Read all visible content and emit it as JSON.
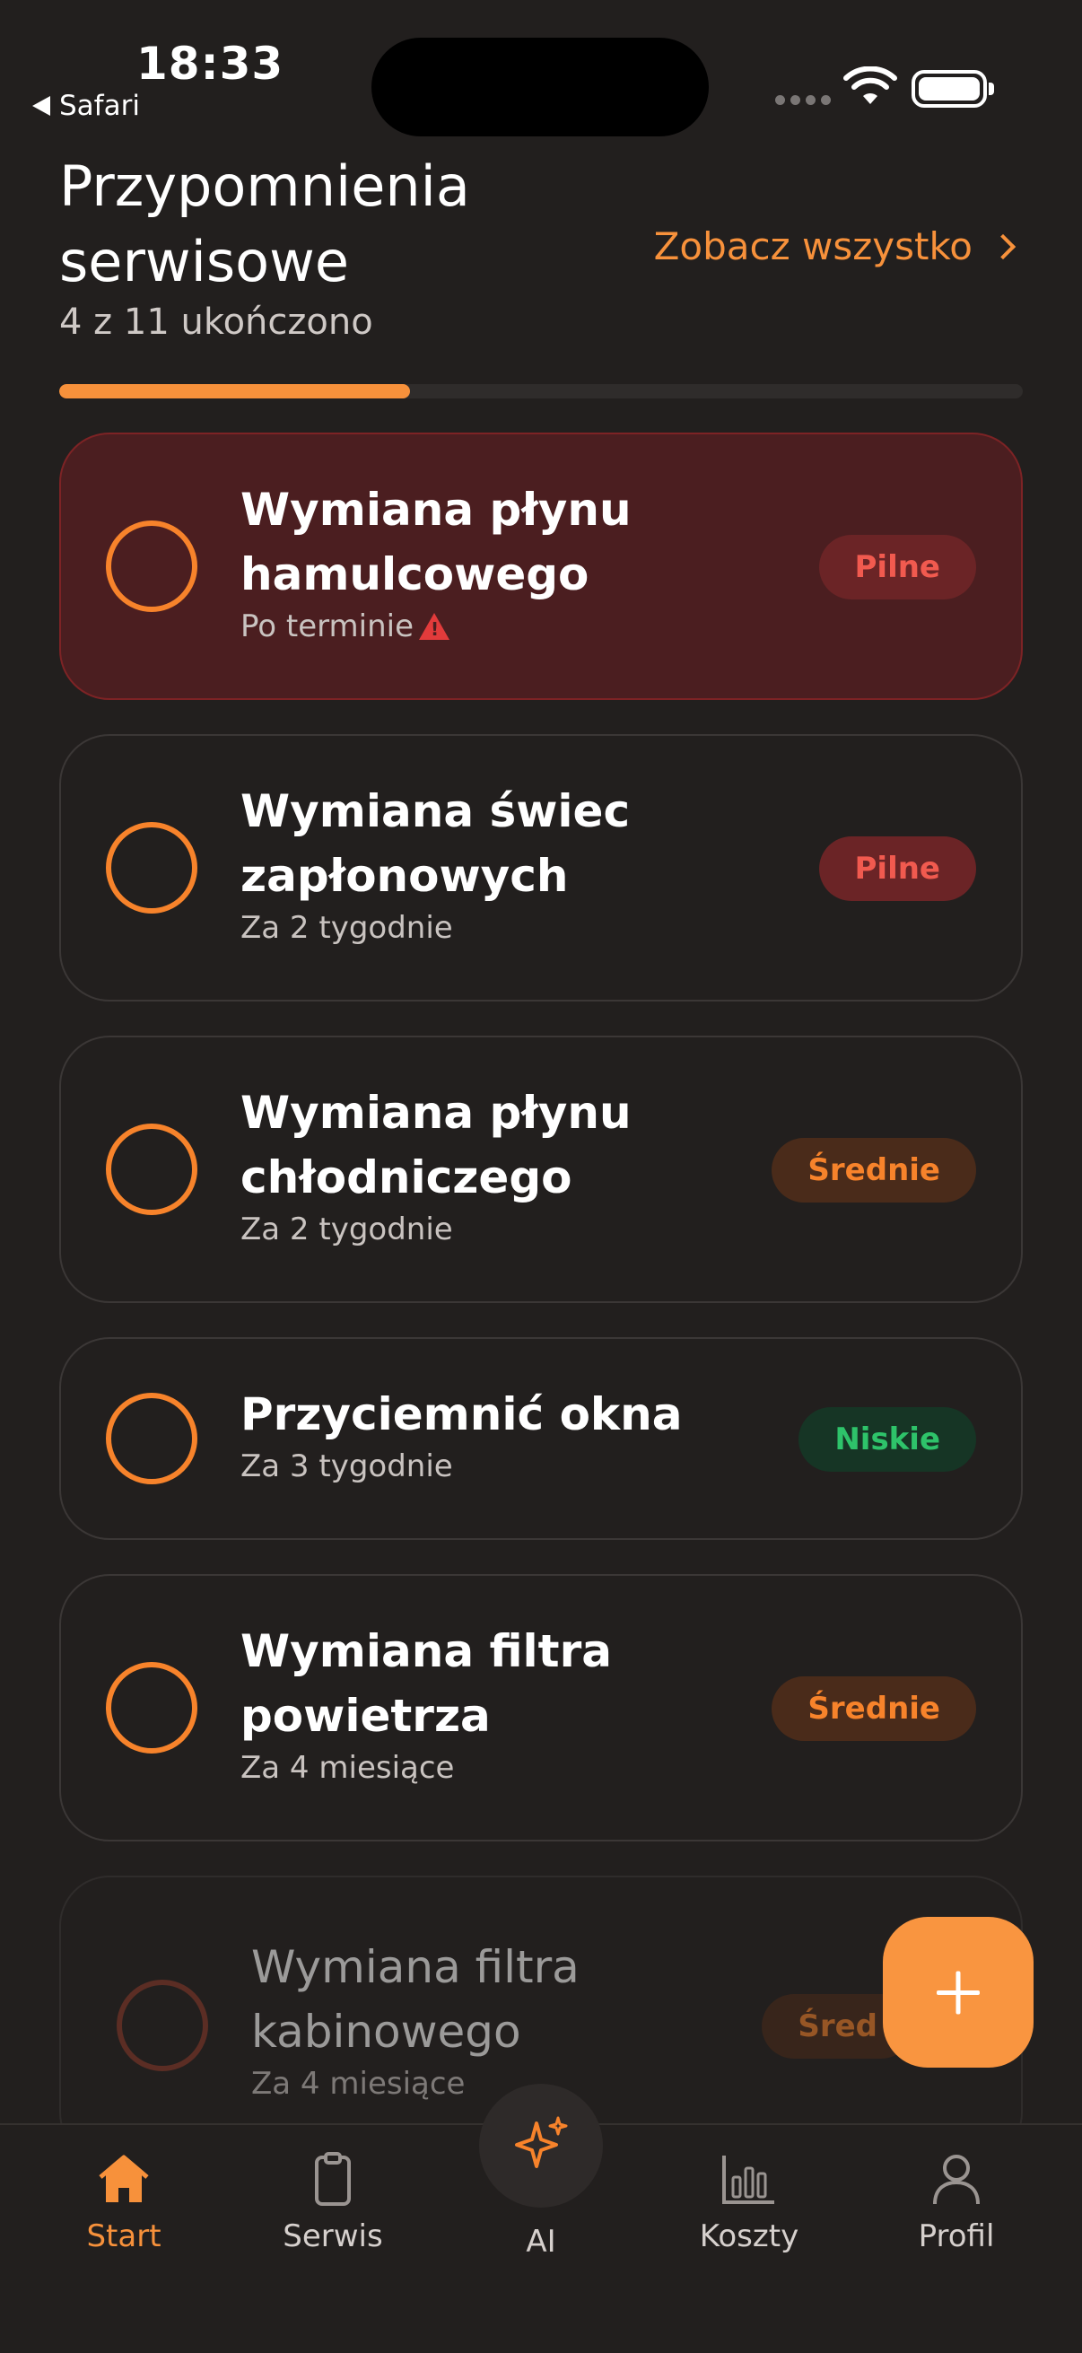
{
  "status_bar": {
    "time": "18:33",
    "back_label": "Safari"
  },
  "header": {
    "title": "Przypomnienia serwisowe",
    "see_all_label": "Zobacz wszystko",
    "subtitle": "4 z 11 ukończono",
    "progress_fraction": 0.3636
  },
  "reminders": [
    {
      "title": "Wymiana płynu hamulcowego",
      "due": "Po terminie",
      "priority": "Pilne",
      "overdue": true
    },
    {
      "title": "Wymiana świec zapłonowych",
      "due": "Za 2 tygodnie",
      "priority": "Pilne"
    },
    {
      "title": "Wymiana płynu chłodniczego",
      "due": "Za 2 tygodnie",
      "priority": "Średnie"
    },
    {
      "title": "Przyciemnić okna",
      "due": "Za 3 tygodnie",
      "priority": "Niskie"
    },
    {
      "title": "Wymiana filtra powietrza",
      "due": "Za 4 miesiące",
      "priority": "Średnie"
    },
    {
      "title": "Wymiana filtra kabinowego",
      "due": "Za 4 miesiące",
      "priority": "Śred"
    }
  ],
  "fab": {
    "icon": "plus-icon"
  },
  "tabbar": {
    "items": [
      {
        "label": "Start",
        "icon": "home-icon",
        "active": true
      },
      {
        "label": "Serwis",
        "icon": "clipboard-icon"
      },
      {
        "label": "AI",
        "icon": "sparkles-icon"
      },
      {
        "label": "Koszty",
        "icon": "bar-chart-icon"
      },
      {
        "label": "Profil",
        "icon": "user-icon"
      }
    ]
  },
  "colors": {
    "accent": "#f7913b",
    "background": "#221f1e",
    "high": "#f15a4f",
    "medium": "#f7832b",
    "low": "#2ec36a"
  }
}
